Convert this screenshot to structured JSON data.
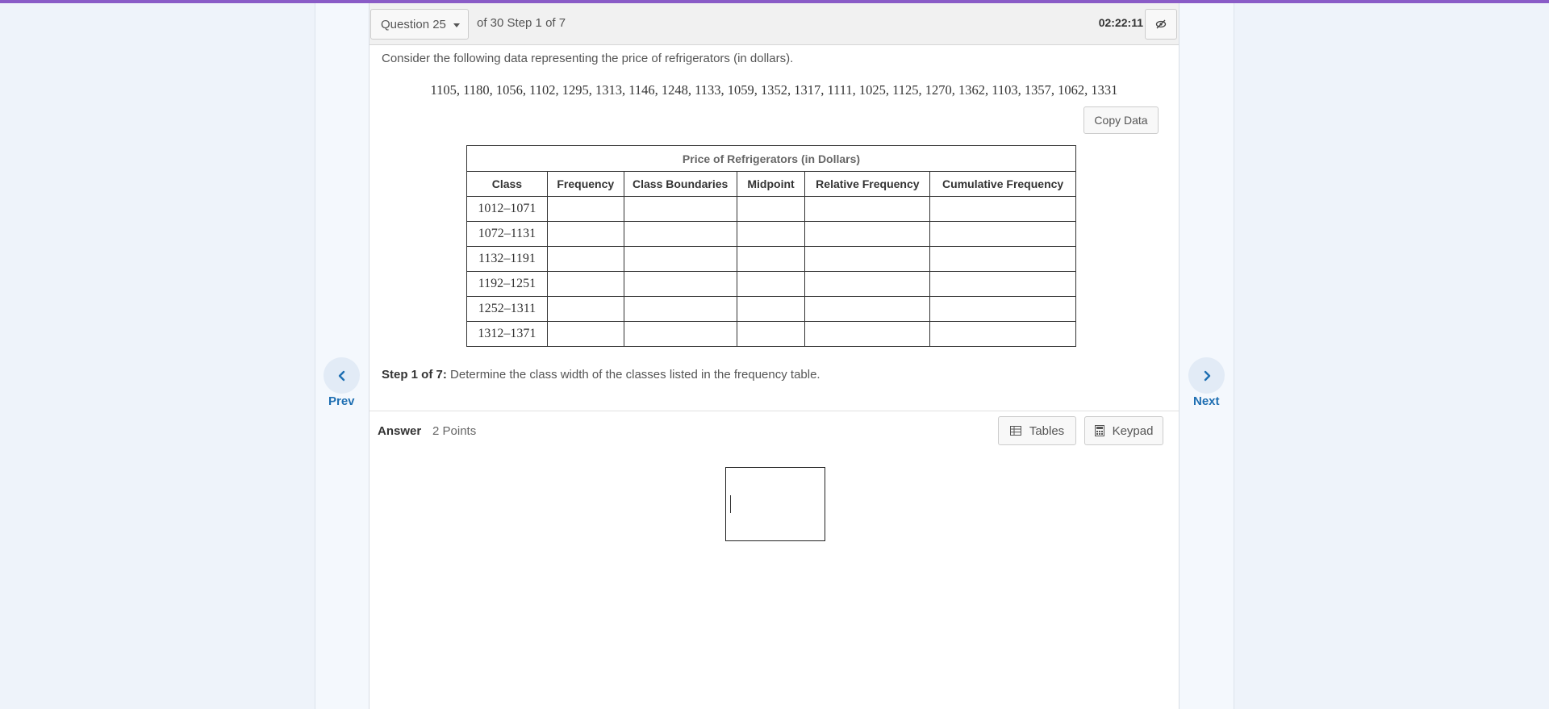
{
  "header": {
    "question_select": "Question 25",
    "of_step": "of 30 Step 1 of 7",
    "timer": "02:22:11"
  },
  "question": {
    "intro": "Consider the following data representing the price of refrigerators (in dollars).",
    "dataset": "1105, 1180, 1056, 1102, 1295, 1313, 1146, 1248, 1133, 1059, 1352, 1317, 1111, 1025, 1125, 1270, 1362, 1103, 1357, 1062, 1331",
    "copy_data_label": "Copy Data"
  },
  "table": {
    "caption": "Price of Refrigerators (in Dollars)",
    "headers": [
      "Class",
      "Frequency",
      "Class Boundaries",
      "Midpoint",
      "Relative Frequency",
      "Cumulative Frequency"
    ],
    "classes": [
      "1012–1071",
      "1072–1131",
      "1132–1191",
      "1192–1251",
      "1252–1311",
      "1312–1371"
    ]
  },
  "step": {
    "label": "Step 1 of 7:",
    "text": " Determine the class width of the classes listed in the frequency table."
  },
  "answer": {
    "label": "Answer",
    "points": "2 Points",
    "tables_label": "Tables",
    "keypad_label": "Keypad"
  },
  "nav": {
    "prev_label": "Prev",
    "next_label": "Next"
  },
  "icons": {
    "prev": "chevron-left-icon",
    "next": "chevron-right-icon",
    "eye": "eye-slash-icon",
    "tables": "table-icon",
    "keypad": "calculator-icon",
    "dropdown": "caret-down-icon"
  },
  "colors": {
    "accent_bar": "#8a5cc7",
    "nav_text": "#1f6fb2",
    "page_bg": "#eef3fa"
  }
}
